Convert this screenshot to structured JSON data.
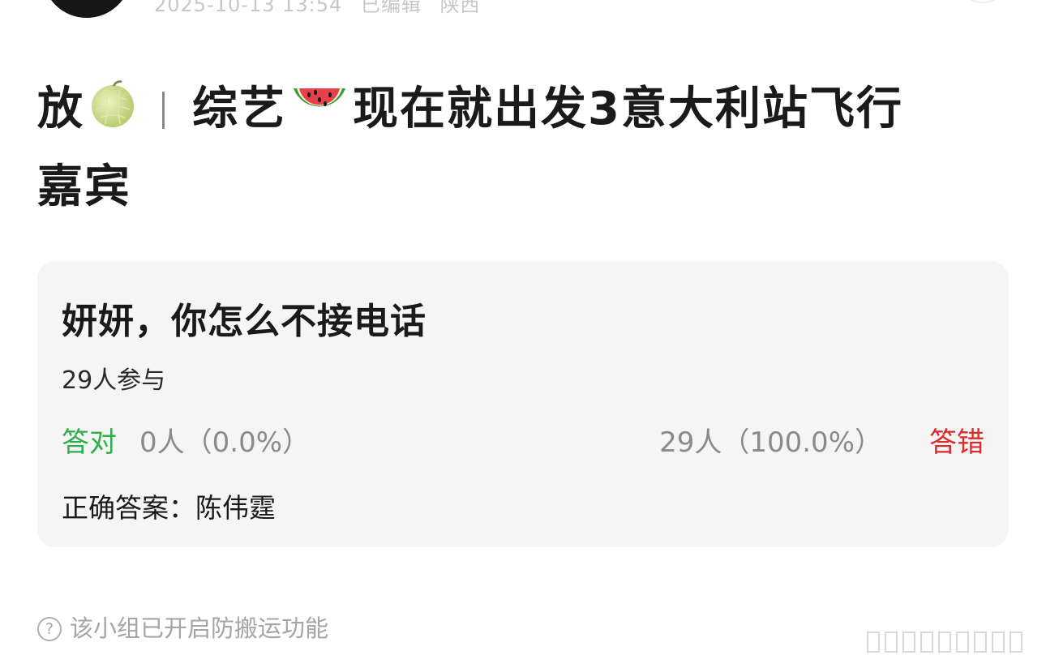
{
  "post": {
    "meta": {
      "date": "2025-10-13 13:54",
      "edited": "已编辑",
      "location": "陕西"
    },
    "title": {
      "part1": "放",
      "part2": "综艺",
      "part3": "现在就出发3意大利站飞行",
      "line2": "嘉宾"
    },
    "icons": [
      "melon-emoji",
      "watermelon-emoji",
      "question-icon"
    ]
  },
  "quiz": {
    "question": "妍妍，你怎么不接电话",
    "participants": "29人参与",
    "correct_label": "答对",
    "correct_count": "0人（0.0%）",
    "wrong_count": "29人（100.0%）",
    "wrong_label": "答错",
    "answer": "正确答案：陈伟霆",
    "colors": {
      "correct": "#2fae4a",
      "wrong": "#d92b2b"
    }
  },
  "footer": {
    "notice": "该小组已开启防搬运功能"
  }
}
